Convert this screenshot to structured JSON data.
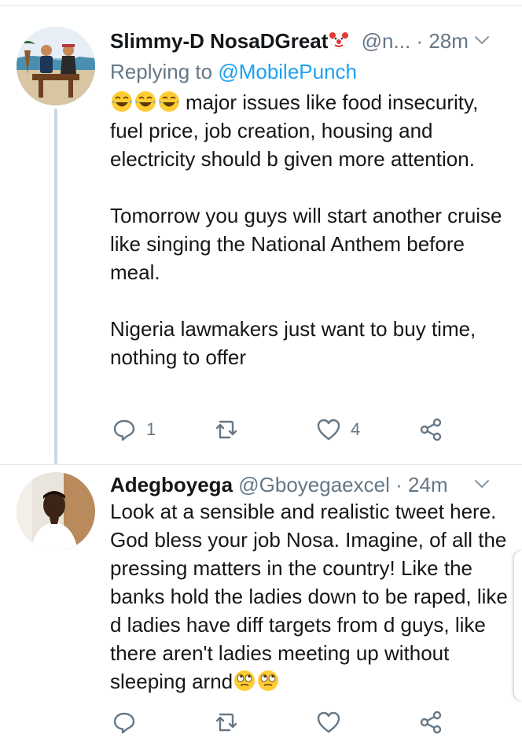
{
  "tweets": [
    {
      "display_name": "Slimmy-D NosaDGreat",
      "handle": "@n...",
      "dot": "·",
      "time": "28m",
      "replying_prefix": "Replying to",
      "replying_to": "@MobilePunch",
      "paragraphs": [
        "major issues like food insecurity, fuel price, job creation, housing and electricity should b given more attention.",
        "Tomorrow you guys will start another cruise like singing the National Anthem before meal.",
        "Nigeria lawmakers just want to buy time, nothing to offer"
      ],
      "reply_count": "1",
      "retweet_count": "",
      "like_count": "4"
    },
    {
      "display_name": "Adegboyega",
      "handle": "@Gboyegaexcel",
      "dot": "·",
      "time": "24m",
      "paragraphs": [
        "Look at a sensible and realistic tweet here. God bless your job Nosa. Imagine, of all the pressing matters in the country! Like the banks hold the ladies down to be raped, like d ladies have diff targets from d guys, like there aren't ladies meeting up without sleeping arnd"
      ],
      "reply_count": "",
      "retweet_count": "",
      "like_count": ""
    }
  ],
  "colors": {
    "text": "#14171a",
    "secondary": "#657786",
    "accent": "#1da1f2",
    "thread_line": "#ccd6dd"
  },
  "icons": [
    "clown-emoji",
    "tears-of-joy-emoji",
    "eye-roll-emoji",
    "chevron-down-icon",
    "reply-icon",
    "retweet-icon",
    "like-icon",
    "share-icon"
  ]
}
